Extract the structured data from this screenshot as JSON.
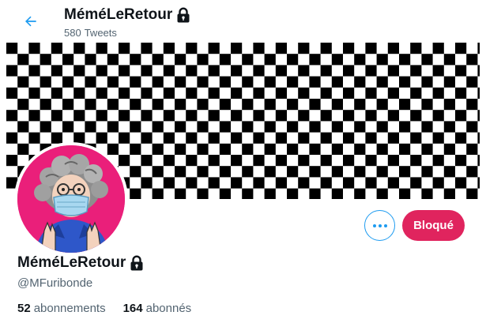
{
  "header": {
    "title": "MéméLeRetour",
    "tweet_count": "580",
    "tweet_label": "Tweets"
  },
  "profile": {
    "display_name": "MéméLeRetour",
    "handle": "@MFuribonde",
    "protected_icon": "lock-icon",
    "banner_pattern": "checkerboard",
    "avatar_bg": "#ea1f7a"
  },
  "actions": {
    "more_icon": "more-horizontal-icon",
    "blocked_label": "Bloqué",
    "blocked_color": "#e0245e",
    "accent": "#1d9bf0"
  },
  "stats": {
    "following_count": "52",
    "following_label": "abonnements",
    "followers_count": "164",
    "followers_label": "abonnés"
  }
}
